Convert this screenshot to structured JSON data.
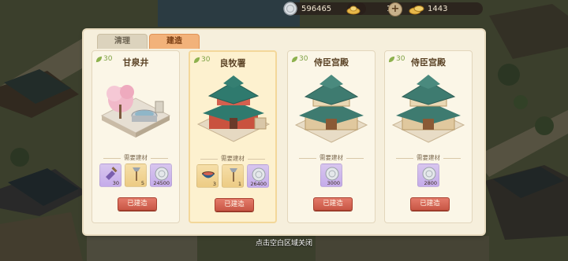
{
  "currencies": {
    "silver": {
      "icon": "silver-coin-icon",
      "value": "596465"
    },
    "ingot": {
      "icon": "gold-ingot-icon",
      "value": "1"
    },
    "gold": {
      "icon": "gold-pile-icon",
      "value": "1443"
    }
  },
  "tabs": [
    {
      "label": "清理",
      "active": false
    },
    {
      "label": "建造",
      "active": true
    }
  ],
  "cards": [
    {
      "prosperity": "30",
      "title": "甘泉井",
      "need_label": "需要建材",
      "materials": [
        {
          "icon": "shovel-icon",
          "qty": "30"
        },
        {
          "icon": "hoe-icon",
          "qty": "5"
        },
        {
          "icon": "silver-coin-icon",
          "qty": "24500"
        }
      ],
      "button": "已建造",
      "selected": false
    },
    {
      "prosperity": "30",
      "title": "良牧署",
      "need_label": "需要建材",
      "materials": [
        {
          "icon": "bowl-icon",
          "qty": "3"
        },
        {
          "icon": "hoe-icon",
          "qty": "1"
        },
        {
          "icon": "silver-coin-icon",
          "qty": "26400"
        }
      ],
      "button": "已建造",
      "selected": true
    },
    {
      "prosperity": "30",
      "title": "侍臣宫殿",
      "need_label": "需要建材",
      "materials": [
        {
          "icon": "silver-coin-icon",
          "qty": "3000"
        }
      ],
      "button": "已建造",
      "selected": false
    },
    {
      "prosperity": "30",
      "title": "侍臣宫殿",
      "need_label": "需要建材",
      "materials": [
        {
          "icon": "silver-coin-icon",
          "qty": "2800"
        }
      ],
      "button": "已建造",
      "selected": false
    }
  ],
  "close_hint": "点击空白区域关闭",
  "colors": {
    "accent_tab": "#f2b27a",
    "button_red": "#d4604f",
    "leaf_green": "#7ea144",
    "panel_bg": "#f6efdc"
  }
}
